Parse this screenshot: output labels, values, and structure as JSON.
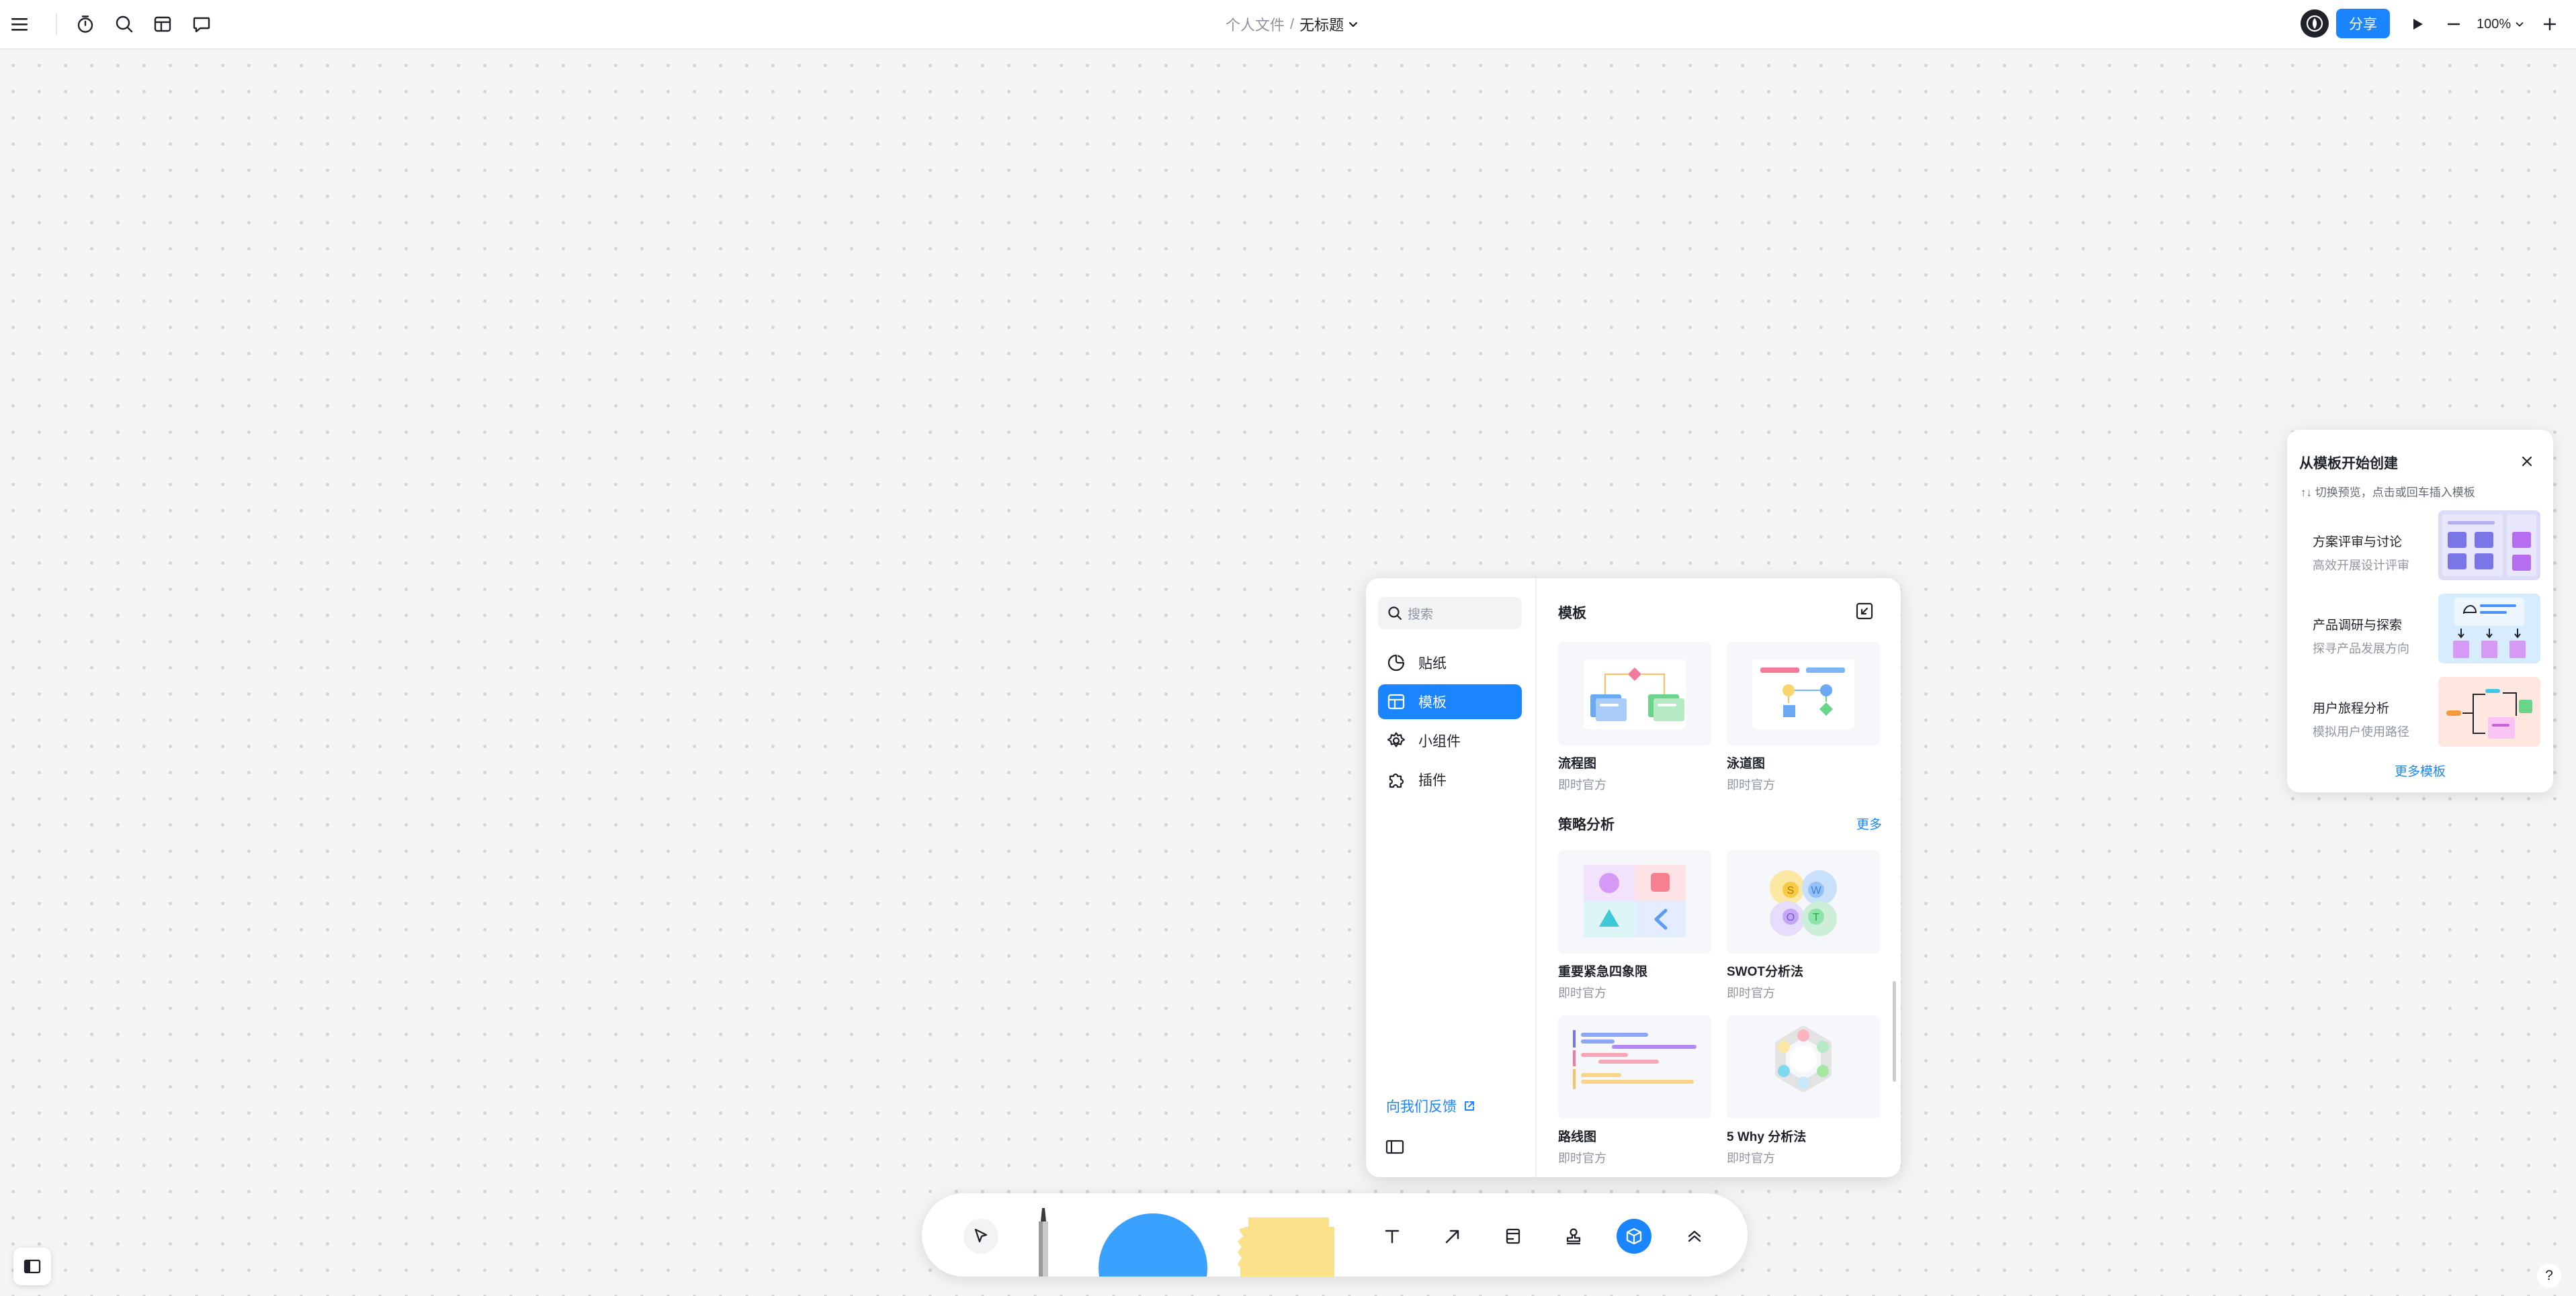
{
  "topbar": {
    "breadcrumb_parent": "个人文件",
    "breadcrumb_sep": "/",
    "doc_title": "无标题",
    "share_label": "分享",
    "zoom_value": "100%",
    "icons": [
      "menu-icon",
      "timer-icon",
      "search-icon",
      "template-library-icon",
      "comment-icon",
      "logo-icon",
      "play-icon",
      "zoom-out-icon",
      "chevron-down-icon",
      "zoom-in-icon"
    ]
  },
  "template_suggest": {
    "title": "从模板开始创建",
    "hint": "↑↓ 切换预览，点击或回车插入模板",
    "items": [
      {
        "title": "方案评审与讨论",
        "subtitle": "高效开展设计评审"
      },
      {
        "title": "产品调研与探索",
        "subtitle": "探寻产品发展方向"
      },
      {
        "title": "用户旅程分析",
        "subtitle": "模拟用户使用路径"
      }
    ],
    "more_label": "更多模板"
  },
  "panel": {
    "search_placeholder": "搜索",
    "nav": [
      {
        "label": "贴纸",
        "icon": "sticker-icon"
      },
      {
        "label": "模板",
        "icon": "template-icon",
        "active": true
      },
      {
        "label": "小组件",
        "icon": "widget-icon"
      },
      {
        "label": "插件",
        "icon": "plugin-icon"
      }
    ],
    "feedback_label": "向我们反馈",
    "section_templates": {
      "title": "模板",
      "cards": [
        {
          "name": "流程图",
          "source": "即时官方"
        },
        {
          "name": "泳道图",
          "source": "即时官方"
        }
      ]
    },
    "section_strategy": {
      "title": "策略分析",
      "more": "更多",
      "cards": [
        {
          "name": "重要紧急四象限",
          "source": "即时官方"
        },
        {
          "name": "SWOT分析法",
          "source": "即时官方"
        },
        {
          "name": "路线图",
          "source": "即时官方"
        },
        {
          "name": "5 Why 分析法",
          "source": "即时官方"
        }
      ],
      "swot_letters": [
        "S",
        "W",
        "O",
        "T"
      ]
    }
  },
  "toolbar": {
    "tools": [
      "select-icon",
      "pen-icon",
      "shape-circle",
      "sticky-note",
      "text-icon",
      "arrow-icon",
      "frame-icon",
      "stamp-icon",
      "materials-icon",
      "expand-up-icon"
    ],
    "active_tool": "materials-icon"
  },
  "help_label": "?",
  "colors": {
    "accent": "#1a85ff",
    "canvas": "#f5f5f5",
    "shape_blue": "#3ba1ff",
    "sticky_yellow": "#fbe08a"
  }
}
